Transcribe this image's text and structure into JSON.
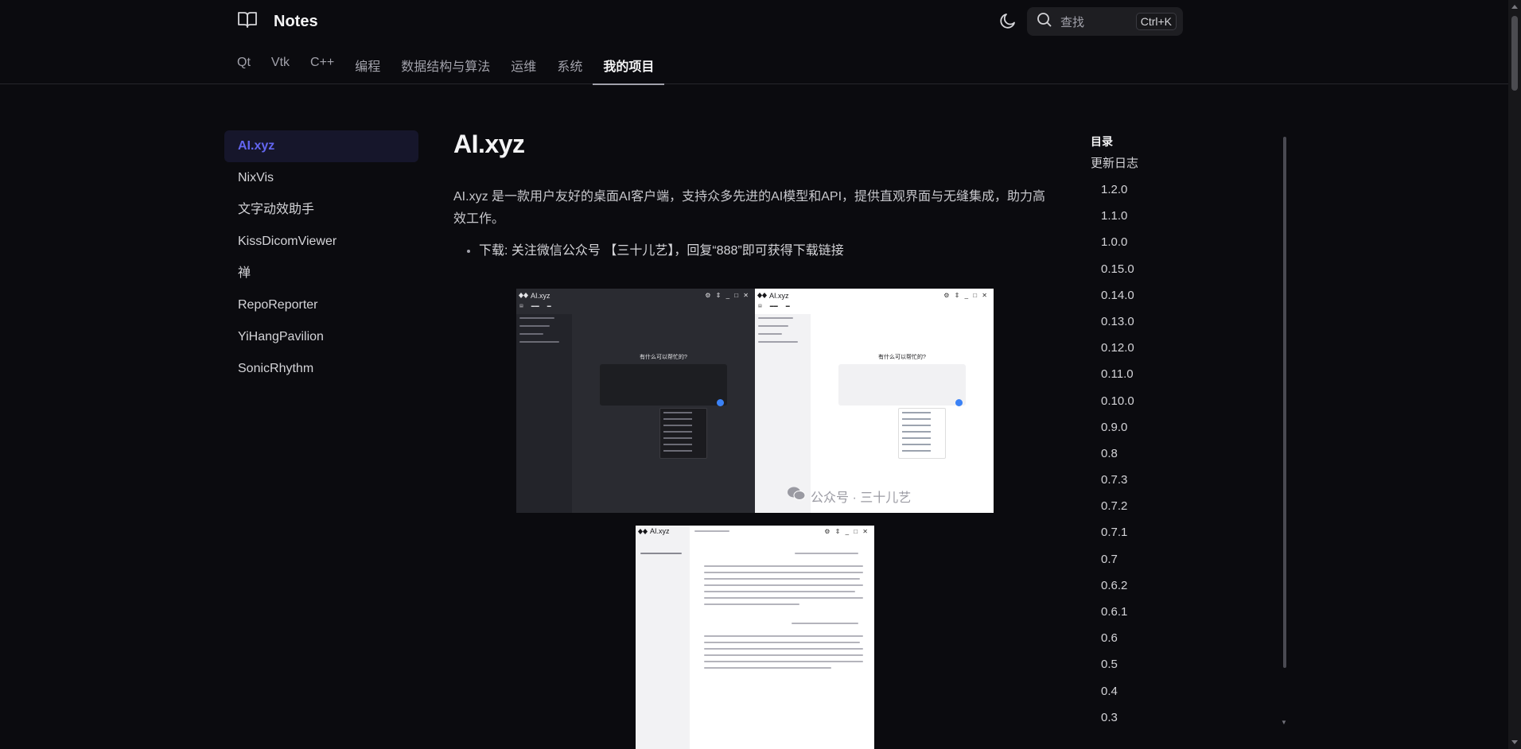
{
  "header": {
    "brand_title": "Notes",
    "search_placeholder": "查找",
    "search_shortcut": "Ctrl+K"
  },
  "nav": {
    "items": [
      "Qt",
      "Vtk",
      "C++",
      "编程",
      "数据结构与算法",
      "运维",
      "系统",
      "我的项目"
    ],
    "active": "我的项目"
  },
  "sidebar": {
    "items": [
      "AI.xyz",
      "NixVis",
      "文字动效助手",
      "KissDicomViewer",
      "禅",
      "RepoReporter",
      "YiHangPavilion",
      "SonicRhythm"
    ],
    "active": "AI.xyz"
  },
  "article": {
    "title": "AI.xyz",
    "intro": "AI.xyz 是一款用户友好的桌面AI客户端，支持众多先进的AI模型和API，提供直观界面与无缝集成，助力高效工作。",
    "bullets": [
      "下载: 关注微信公众号 【三十儿艺】，回复“888”即可获得下载链接"
    ],
    "screenshot": {
      "app_title": "AI.xyz",
      "question": "有什么可以帮忙的?",
      "watermark": "公众号 · 三十儿艺"
    }
  },
  "toc": {
    "title": "目录",
    "section": "更新日志",
    "versions": [
      "1.2.0",
      "1.1.0",
      "1.0.0",
      "0.15.0",
      "0.14.0",
      "0.13.0",
      "0.12.0",
      "0.11.0",
      "0.10.0",
      "0.9.0",
      "0.8",
      "0.7.3",
      "0.7.2",
      "0.7.1",
      "0.7",
      "0.6.2",
      "0.6.1",
      "0.6",
      "0.5",
      "0.4",
      "0.3"
    ]
  },
  "colors": {
    "background": "#0b0b0f",
    "accent": "#6366f1",
    "active_bg": "#16162b"
  }
}
